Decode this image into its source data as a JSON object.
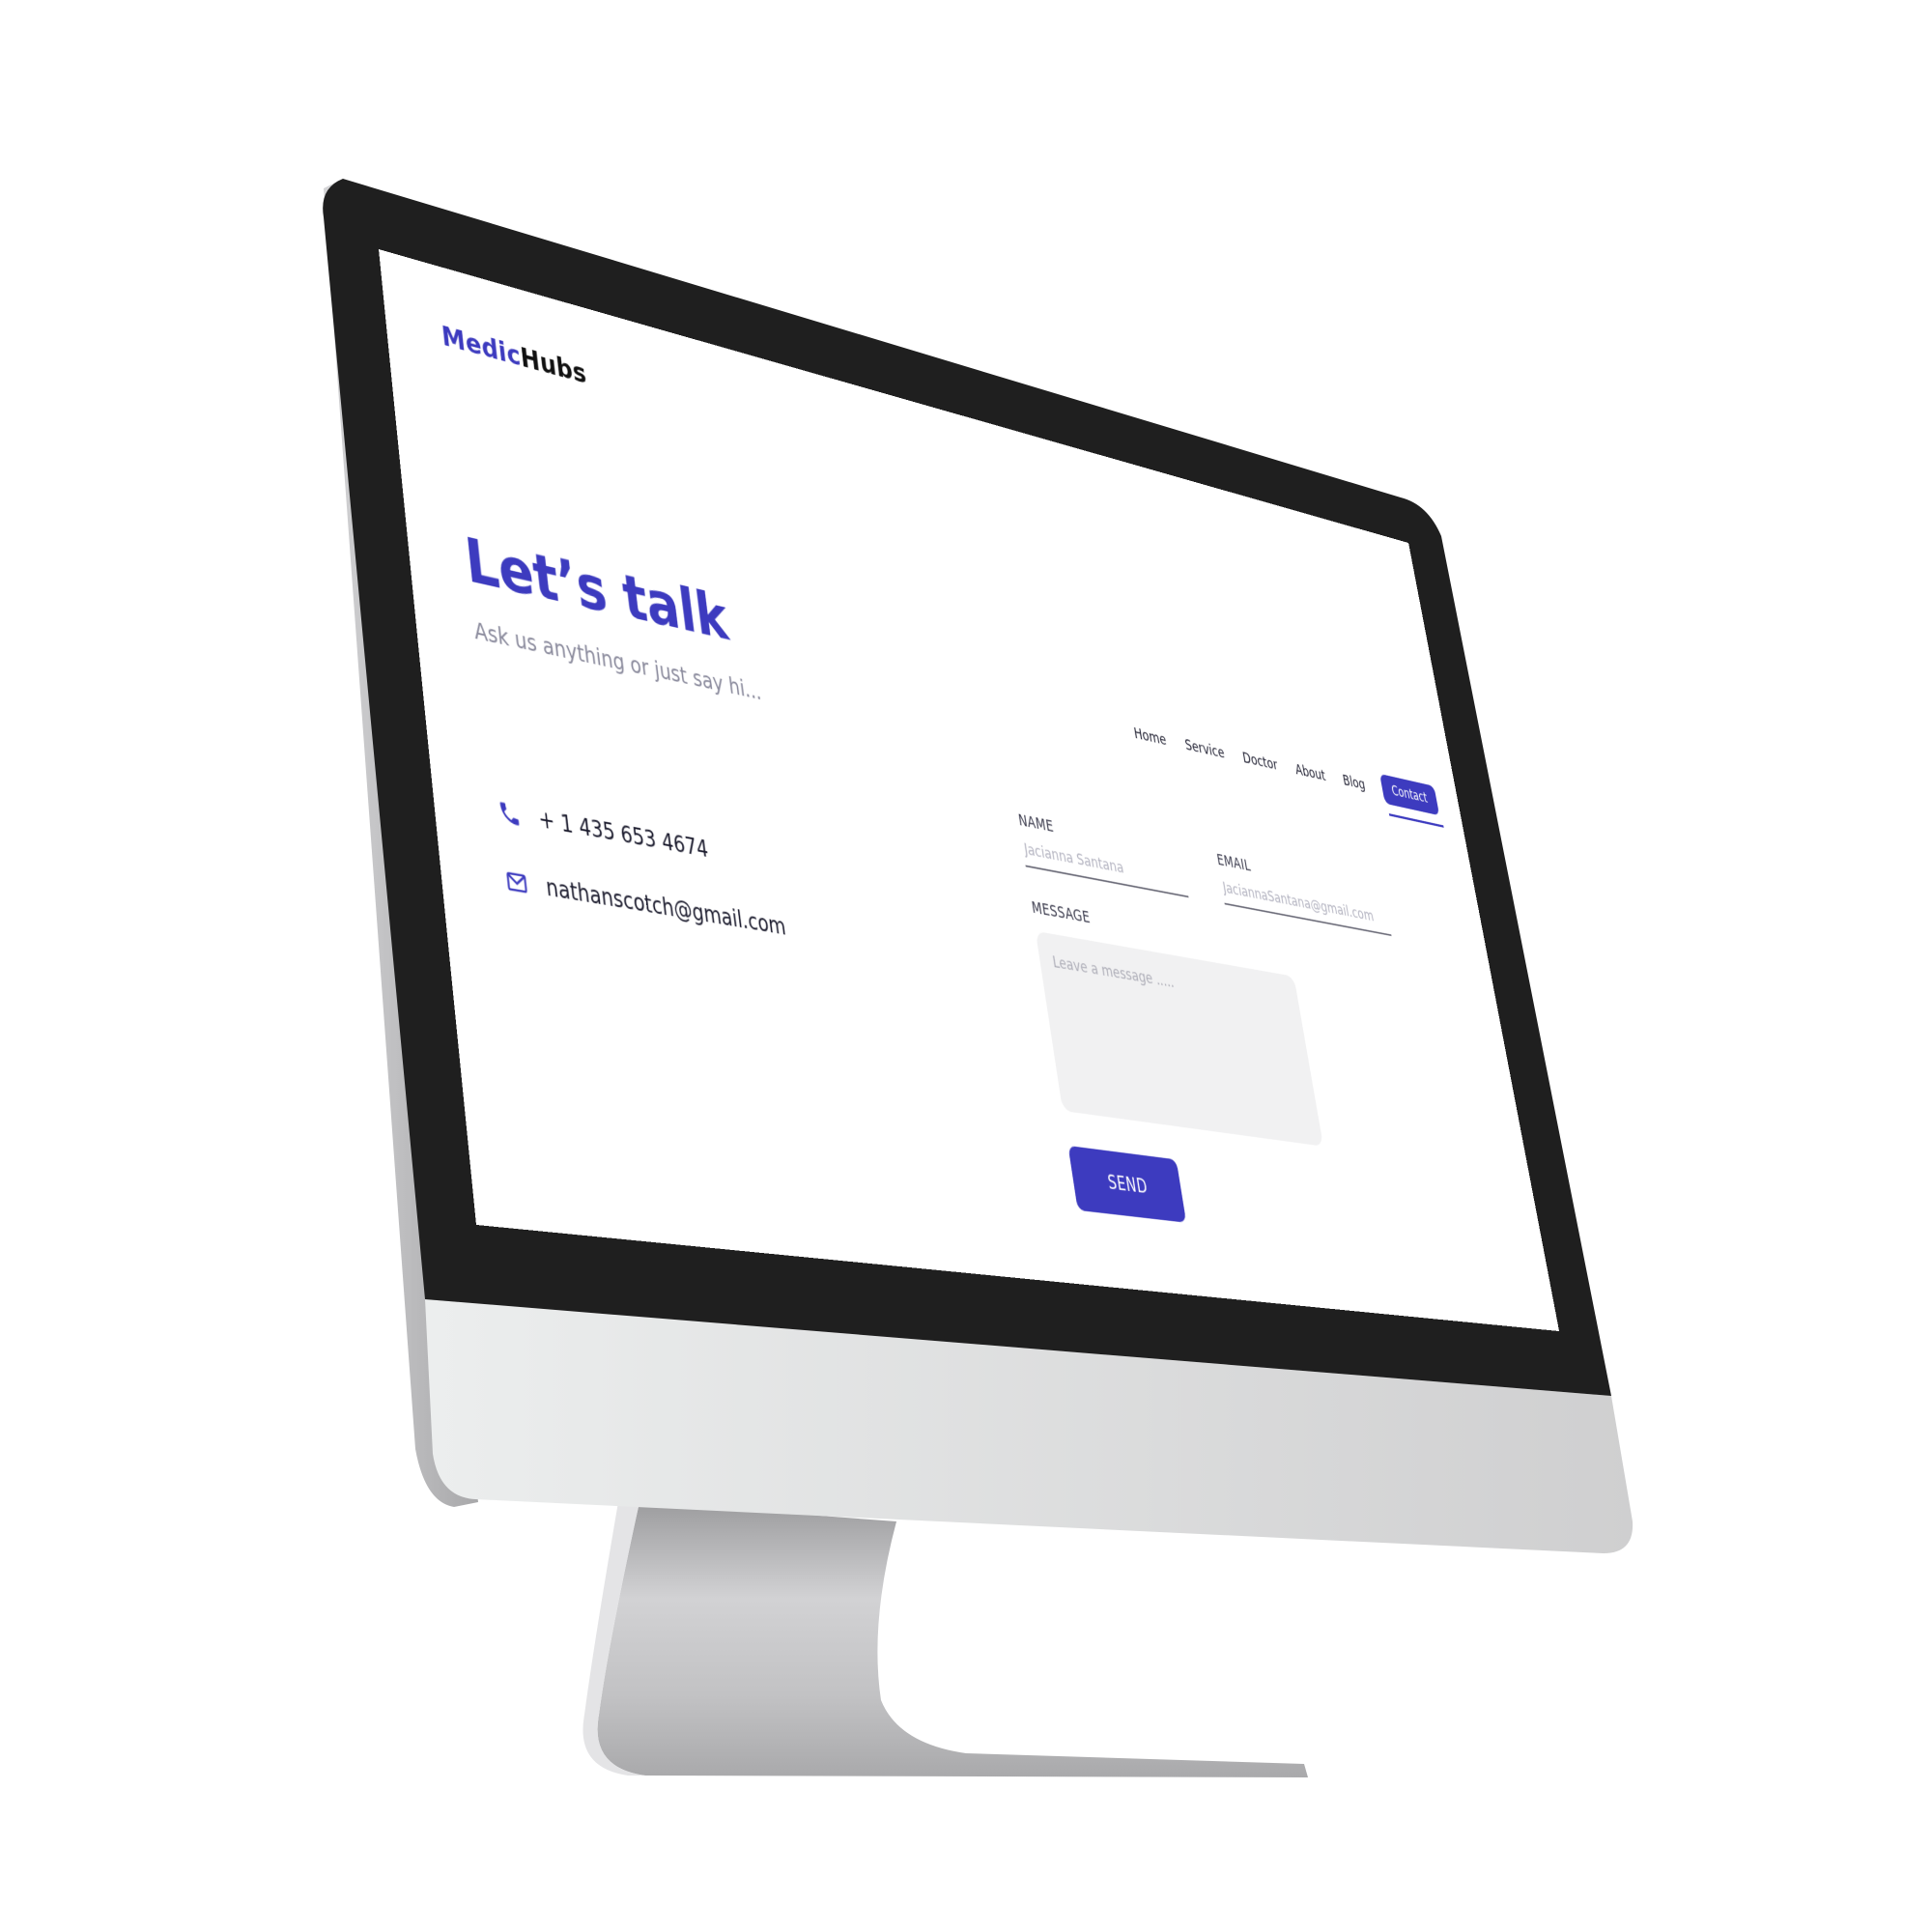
{
  "brand": {
    "name_part1": "Medic",
    "name_part2": "Hubs",
    "accent_color": "#3d3bbf"
  },
  "nav": {
    "items": [
      {
        "label": "Home"
      },
      {
        "label": "Service"
      },
      {
        "label": "Doctor"
      },
      {
        "label": "About"
      },
      {
        "label": "Blog"
      }
    ],
    "active": {
      "label": "Contact"
    }
  },
  "hero": {
    "title": "Let’s talk",
    "subtitle": "Ask us anything or just say hi..."
  },
  "contact_info": {
    "phone": "+ 1 435 653 4674",
    "email": "nathanscotch@gmail.com",
    "phone_icon": "phone-icon",
    "email_icon": "mail-icon"
  },
  "form": {
    "name_label": "NAME",
    "name_placeholder": "Jacianna Santana",
    "email_label": "EMAIL",
    "email_placeholder": "JaciannaSantana@gmail.com",
    "message_label": "MESSAGE",
    "message_placeholder": "Leave a message .....",
    "send_label": "SEND"
  }
}
